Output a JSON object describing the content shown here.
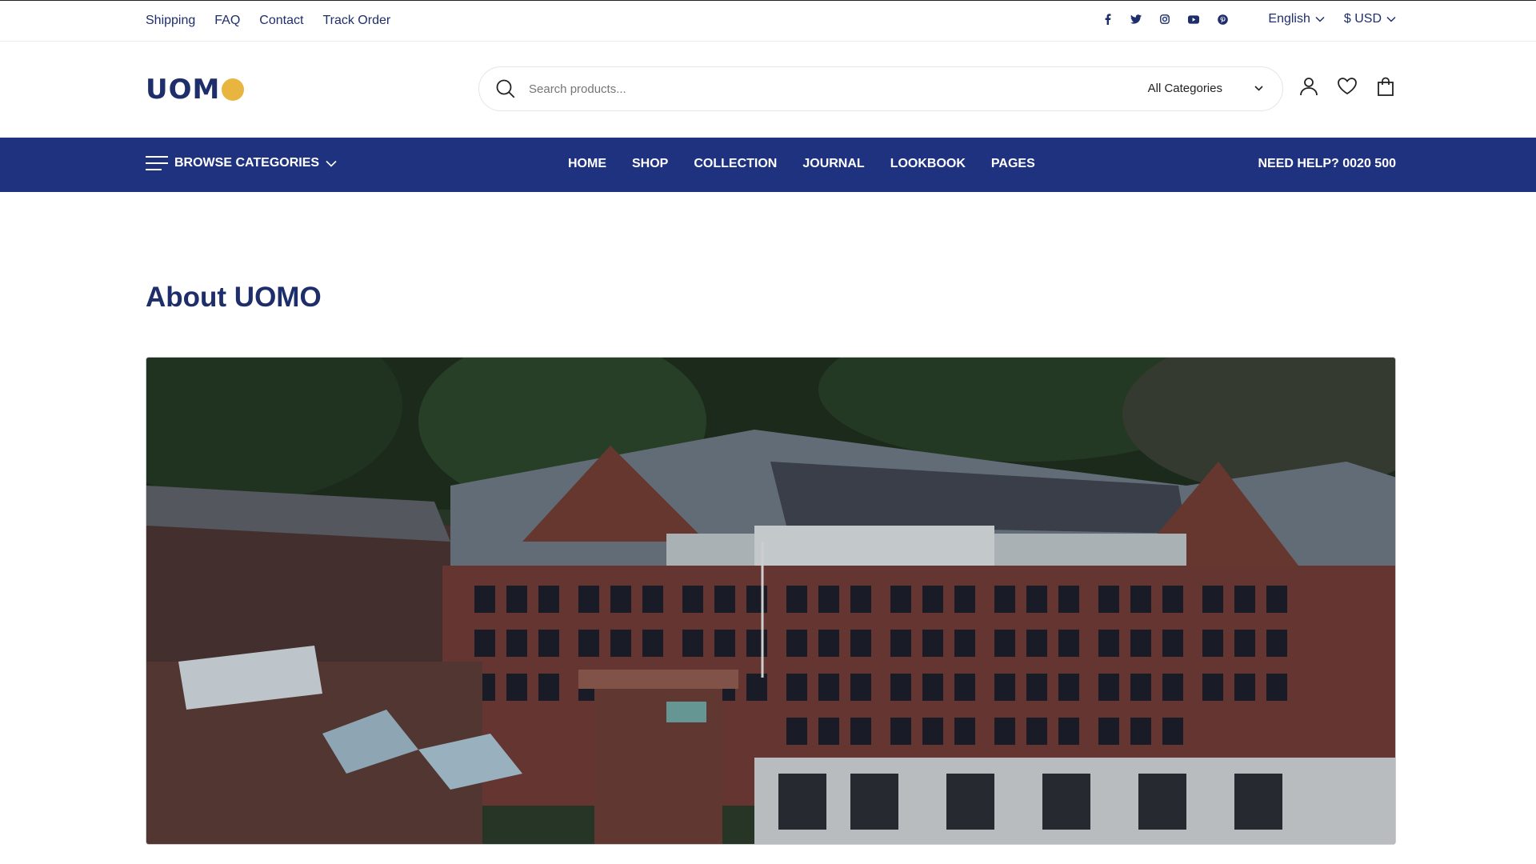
{
  "topbar": {
    "links": [
      "Shipping",
      "FAQ",
      "Contact",
      "Track Order"
    ],
    "language": "English",
    "currency": "$ USD"
  },
  "search": {
    "placeholder": "Search products...",
    "category": "All Categories"
  },
  "logo": {
    "text": "UOM"
  },
  "nav": {
    "browse": "BROWSE CATEGORIES",
    "items": [
      "HOME",
      "SHOP",
      "COLLECTION",
      "JOURNAL",
      "LOOKBOOK",
      "PAGES"
    ],
    "help": "NEED HELP? 0020 500"
  },
  "page": {
    "title": "About UOMO"
  },
  "colors": {
    "navy": "#1e3280",
    "text": "#1e2e6b",
    "accent": "#e8b540"
  }
}
